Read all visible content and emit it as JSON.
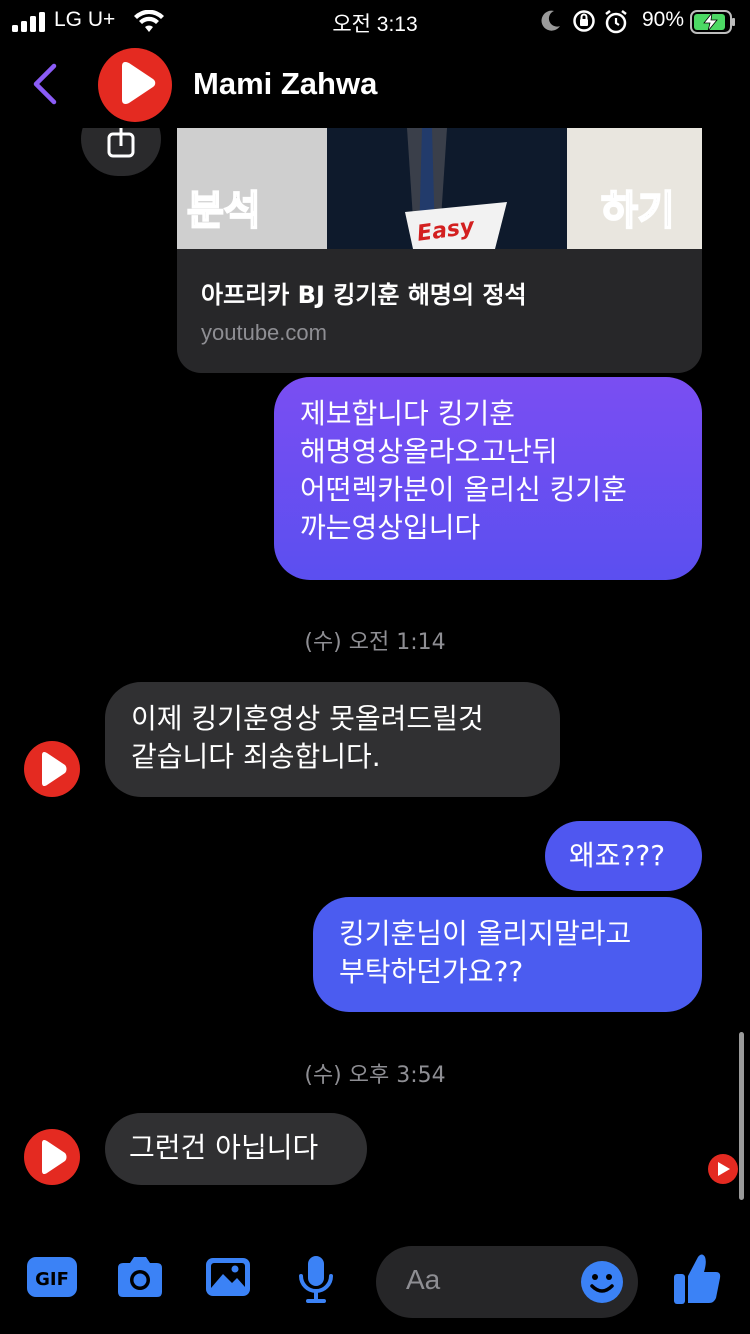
{
  "status_bar": {
    "carrier": "LG U+",
    "time": "오전 3:13",
    "battery_percent": "90%",
    "icons": [
      "signal-icon",
      "wifi-icon",
      "moon-icon",
      "rotation-lock-icon",
      "alarm-icon",
      "battery-charging-icon"
    ]
  },
  "header": {
    "contact_name": "Mami Zahwa",
    "back_icon": "chevron-left-icon",
    "accent_color": "#8b5cf6"
  },
  "link_card": {
    "thumbnail_texts": [
      "분석",
      "하기",
      "Easy"
    ],
    "title": "아프리카 BJ 킹기훈 해명의 정석",
    "domain": "youtube.com"
  },
  "messages": [
    {
      "id": "m1",
      "side": "sent",
      "lines": [
        "제보합니다 킹기훈",
        "해명영상올라오고난뒤",
        "어떤렉카분이 올리신 킹기훈",
        "까는영상입니다"
      ]
    },
    {
      "id": "t1",
      "type": "timestamp",
      "text": "(수) 오전 1:14"
    },
    {
      "id": "m2",
      "side": "received",
      "lines": [
        "이제 킹기훈영상 못올려드릴것",
        "같습니다 죄송합니다."
      ]
    },
    {
      "id": "m3",
      "side": "sent",
      "lines": [
        "왜죠???"
      ]
    },
    {
      "id": "m4",
      "side": "sent",
      "lines": [
        "킹기훈님이 올리지말라고",
        "부탁하던가요??"
      ]
    },
    {
      "id": "t2",
      "type": "timestamp",
      "text": "(수) 오후 3:54"
    },
    {
      "id": "m5",
      "side": "received",
      "lines": [
        "그런건 아닙니다"
      ]
    }
  ],
  "composer": {
    "placeholder": "Aa",
    "tools": [
      "gif-icon",
      "camera-icon",
      "image-icon",
      "microphone-icon"
    ],
    "emoji_icon": "emoji-icon",
    "like_icon": "thumbs-up-icon"
  },
  "colors": {
    "sent_bubble": "#5b4ff0",
    "received_bubble": "#303032",
    "avatar": "#e42a21",
    "composer_icon": "#3b82f6"
  }
}
